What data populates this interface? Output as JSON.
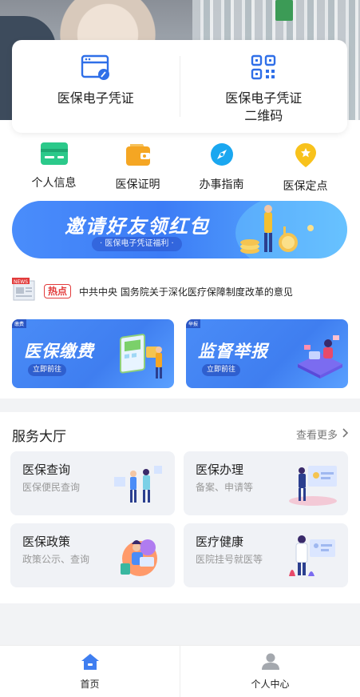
{
  "top_card": {
    "left_label": "医保电子凭证",
    "right_label_line1": "医保电子凭证",
    "right_label_line2": "二维码"
  },
  "quick_links": [
    {
      "label": "个人信息",
      "icon": "id-card-icon",
      "color": "#2bc98a"
    },
    {
      "label": "医保证明",
      "icon": "wallet-icon",
      "color": "#f5a623"
    },
    {
      "label": "办事指南",
      "icon": "compass-icon",
      "color": "#1aa7f0"
    },
    {
      "label": "医保定点",
      "icon": "location-pin-icon",
      "color": "#f8c21c"
    }
  ],
  "banner": {
    "title": "邀请好友领红包",
    "subtitle": "· 医保电子凭证福利 ·"
  },
  "news": {
    "tag": "热点",
    "text": "中共中央 国务院关于深化医疗保障制度改革的意见",
    "icon": "news-icon"
  },
  "features": [
    {
      "title": "医保缴费",
      "button": "立即前往",
      "mini_tag": "缴费"
    },
    {
      "title": "监督举报",
      "button": "立即前往",
      "mini_tag": "举报"
    }
  ],
  "hall": {
    "title": "服务大厅",
    "more": "查看更多",
    "services": [
      {
        "title": "医保查询",
        "subtitle": "医保便民查询"
      },
      {
        "title": "医保办理",
        "subtitle": "备案、申请等"
      },
      {
        "title": "医保政策",
        "subtitle": "政策公示、查询"
      },
      {
        "title": "医疗健康",
        "subtitle": "医院挂号就医等"
      }
    ]
  },
  "tabbar": {
    "home": "首页",
    "profile": "个人中心"
  },
  "colors": {
    "accent": "#3f7ef0",
    "hot_tag": "#e23b3b"
  }
}
